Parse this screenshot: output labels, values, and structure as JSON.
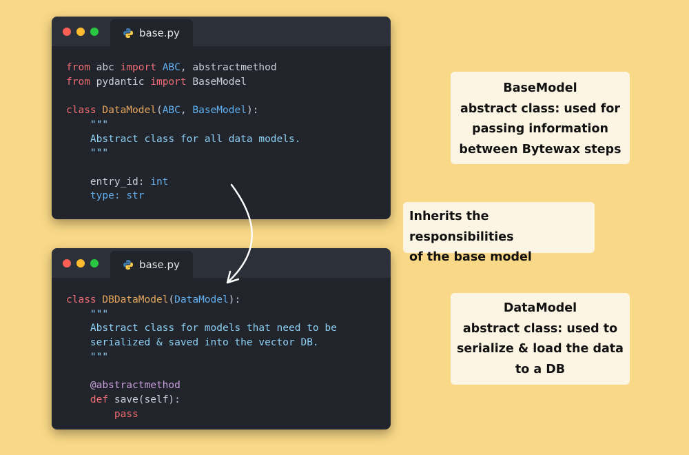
{
  "windows": [
    {
      "tab_label": "base.py",
      "lines": [
        [
          {
            "t": "from",
            "c": "kw"
          },
          {
            "t": " abc "
          },
          {
            "t": "import",
            "c": "kw"
          },
          {
            "t": " "
          },
          {
            "t": "ABC",
            "c": "bl"
          },
          {
            "t": ", abstractmethod"
          }
        ],
        [
          {
            "t": "from",
            "c": "kw"
          },
          {
            "t": " pydantic "
          },
          {
            "t": "import",
            "c": "kw"
          },
          {
            "t": " BaseModel"
          }
        ],
        [],
        [
          {
            "t": "class",
            "c": "kw"
          },
          {
            "t": " "
          },
          {
            "t": "DataModel",
            "c": "cls"
          },
          {
            "t": "("
          },
          {
            "t": "ABC",
            "c": "bl"
          },
          {
            "t": ", "
          },
          {
            "t": "BaseModel",
            "c": "bl"
          },
          {
            "t": "):"
          }
        ],
        [
          {
            "t": "    \"\"\"",
            "c": "doc"
          }
        ],
        [
          {
            "t": "    Abstract class for all data models.",
            "c": "doc"
          }
        ],
        [
          {
            "t": "    \"\"\"",
            "c": "doc"
          }
        ],
        [],
        [
          {
            "t": "    entry_id: "
          },
          {
            "t": "int",
            "c": "bl"
          }
        ],
        [
          {
            "t": "    type: ",
            "c": "bl"
          },
          {
            "t": "str",
            "c": "bl"
          }
        ]
      ]
    },
    {
      "tab_label": "base.py",
      "lines": [
        [
          {
            "t": "class",
            "c": "kw"
          },
          {
            "t": " "
          },
          {
            "t": "DBDataModel",
            "c": "cls"
          },
          {
            "t": "("
          },
          {
            "t": "DataModel",
            "c": "bl"
          },
          {
            "t": "):"
          }
        ],
        [
          {
            "t": "    \"\"\"",
            "c": "doc"
          }
        ],
        [
          {
            "t": "    Abstract class for models that need to be",
            "c": "doc"
          }
        ],
        [
          {
            "t": "    serialized & saved into the vector DB.",
            "c": "doc"
          }
        ],
        [
          {
            "t": "    \"\"\"",
            "c": "doc"
          }
        ],
        [],
        [
          {
            "t": "    "
          },
          {
            "t": "@abstractmethod",
            "c": "dec"
          }
        ],
        [
          {
            "t": "    "
          },
          {
            "t": "def",
            "c": "kw"
          },
          {
            "t": " save(self):"
          }
        ],
        [
          {
            "t": "        "
          },
          {
            "t": "pass",
            "c": "kw"
          }
        ]
      ]
    }
  ],
  "notes": {
    "basemodel": [
      "BaseModel",
      "abstract class: used for",
      "passing information",
      "between Bytewax steps"
    ],
    "inherits": [
      "Inherits the responsibilities",
      "of the base model"
    ],
    "datamodel": [
      "DataModel",
      "abstract class: used to",
      "serialize & load the data",
      "to a DB"
    ]
  },
  "colors": {
    "background": "#f9d987",
    "editor": "#21252b",
    "keyword": "#ef6b73",
    "class_name": "#e5a45a",
    "builtin": "#61afef",
    "docstring": "#8fd0f5",
    "decorator": "#c9a0dc",
    "note": "#fdf5e4"
  },
  "icons": {
    "tab_icon": "python-icon",
    "window_controls": [
      "close-dot",
      "minimize-dot",
      "maximize-dot"
    ],
    "connector": "curved-arrow"
  }
}
